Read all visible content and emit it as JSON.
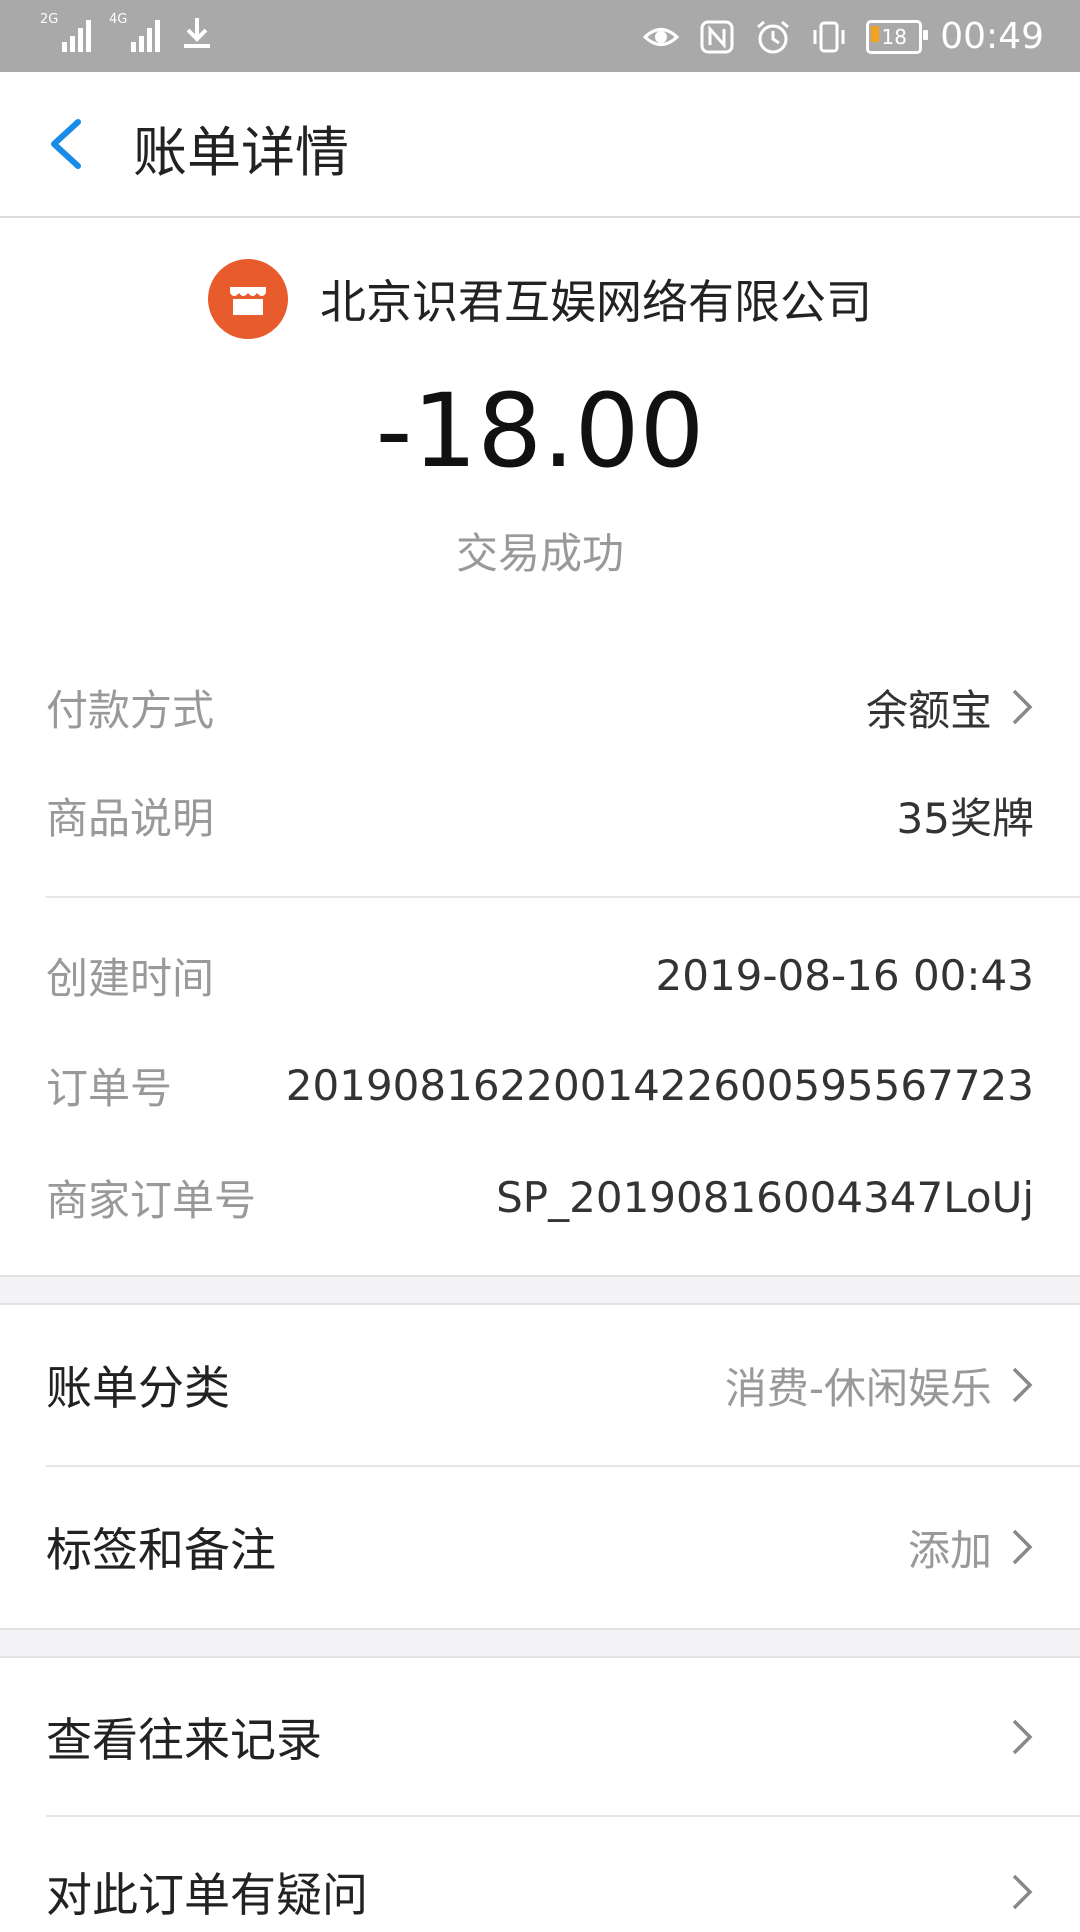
{
  "status_bar": {
    "sim1_label": "2G",
    "sim2_label": "4G",
    "battery_level": "18",
    "time": "00:49"
  },
  "nav": {
    "title": "账单详情"
  },
  "merchant": {
    "name": "北京识君互娱网络有限公司",
    "logo_color": "#e85b2c"
  },
  "transaction": {
    "amount": "-18.00",
    "status": "交易成功"
  },
  "details": {
    "payment_method": {
      "label": "付款方式",
      "value": "余额宝"
    },
    "product_desc": {
      "label": "商品说明",
      "value": "35奖牌"
    },
    "created_time": {
      "label": "创建时间",
      "value": "2019-08-16 00:43"
    },
    "order_no": {
      "label": "订单号",
      "value": "2019081622001422600595567723"
    },
    "merchant_order_no": {
      "label": "商家订单号",
      "value": "SP_20190816004347LoUj"
    }
  },
  "actions": {
    "category": {
      "label": "账单分类",
      "value": "消费-休闲娱乐"
    },
    "tags": {
      "label": "标签和备注",
      "value": "添加"
    },
    "history": {
      "label": "查看往来记录"
    },
    "question": {
      "label": "对此订单有疑问"
    }
  },
  "colors": {
    "accent_blue": "#1a8be8",
    "status_bar_bg": "#a9a9a9",
    "muted_text": "#999999"
  }
}
